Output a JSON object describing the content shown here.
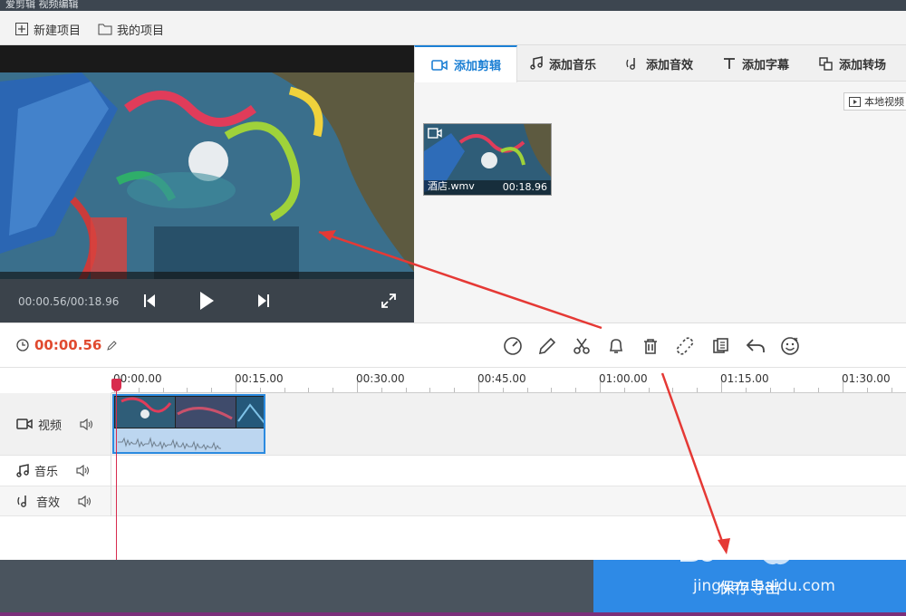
{
  "window": {
    "title": "爱剪辑 视频编辑"
  },
  "menubar": {
    "new_project": "新建项目",
    "my_projects": "我的项目"
  },
  "preview": {
    "current_time": "00:00.56",
    "duration": "00:18.96",
    "time_separator": "/"
  },
  "tabs": [
    {
      "label": "添加剪辑",
      "icon": "video-camera-icon",
      "active": true
    },
    {
      "label": "添加音乐",
      "icon": "music-note-icon"
    },
    {
      "label": "添加音效",
      "icon": "sound-effect-icon"
    },
    {
      "label": "添加字幕",
      "icon": "text-t-icon"
    },
    {
      "label": "添加转场",
      "icon": "transition-icon"
    }
  ],
  "media": {
    "local_video_button": "本地视频",
    "clips": [
      {
        "name": "酒店.wmv",
        "duration": "00:18.96"
      }
    ]
  },
  "toolbar": {
    "timecode": "00:00.56",
    "tools": [
      "speed-icon",
      "pencil-icon",
      "scissors-icon",
      "bell-icon",
      "trash-icon",
      "unlink-icon",
      "copy-icon",
      "undo-icon",
      "emoji-icon"
    ]
  },
  "ruler": {
    "labels": [
      "00:00.00",
      "00:15.00",
      "00:30.00",
      "00:45.00",
      "01:00.00",
      "01:15.00",
      "01:30.00"
    ]
  },
  "tracks": [
    {
      "label": "视频",
      "icon": "video-camera-icon"
    },
    {
      "label": "音乐",
      "icon": "music-note-icon"
    },
    {
      "label": "音效",
      "icon": "sound-effect-icon"
    }
  ],
  "export": {
    "label": "保存导出"
  },
  "watermark": {
    "brand": "Bai 经验",
    "url": "jingyan.baidu.com"
  },
  "colors": {
    "accent": "#1b7fd4",
    "timecode": "#e04a2f",
    "playhead": "#d82c4e",
    "export_bg": "#2e8ae6",
    "annotation_arrow": "#e53935"
  }
}
